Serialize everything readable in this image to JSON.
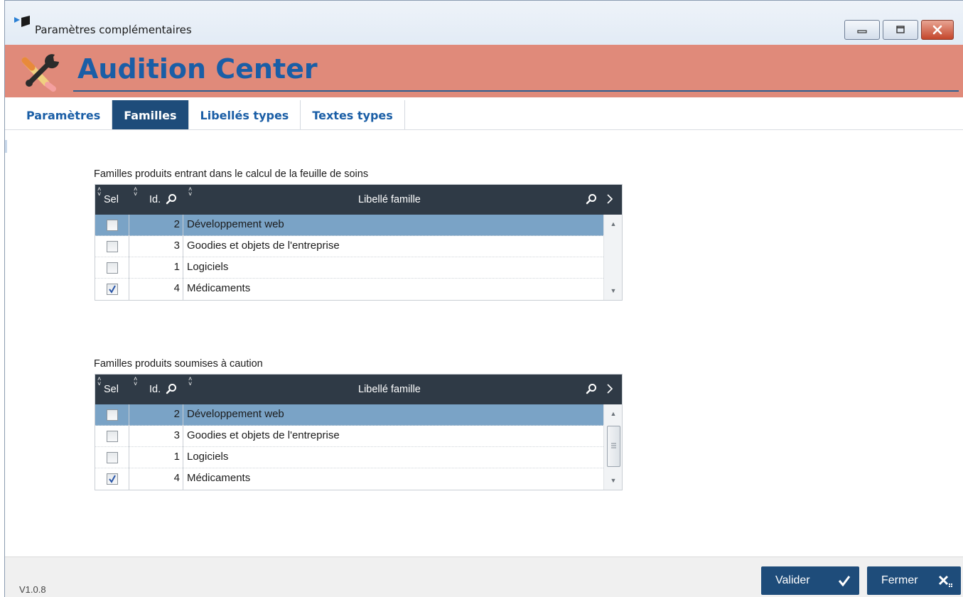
{
  "window": {
    "title": "Paramètres complémentaires"
  },
  "banner": {
    "title": "Audition Center"
  },
  "tabs": [
    {
      "label": "Paramètres",
      "active": false
    },
    {
      "label": "Familles",
      "active": true
    },
    {
      "label": "Libellés types",
      "active": false
    },
    {
      "label": "Textes types",
      "active": false
    }
  ],
  "grid1": {
    "caption": "Familles produits entrant dans le calcul de la feuille de soins",
    "headers": {
      "sel": "Sel",
      "id": "Id.",
      "libelle": "Libellé famille"
    },
    "rows": [
      {
        "id": "2",
        "libelle": "Développement web",
        "checked": false,
        "selected": true
      },
      {
        "id": "3",
        "libelle": "Goodies et objets de l'entreprise",
        "checked": false,
        "selected": false
      },
      {
        "id": "1",
        "libelle": "Logiciels",
        "checked": false,
        "selected": false
      },
      {
        "id": "4",
        "libelle": "Médicaments",
        "checked": true,
        "selected": false
      }
    ]
  },
  "grid2": {
    "caption": "Familles produits soumises à caution",
    "headers": {
      "sel": "Sel",
      "id": "Id.",
      "libelle": "Libellé famille"
    },
    "rows": [
      {
        "id": "2",
        "libelle": "Développement web",
        "checked": false,
        "selected": true
      },
      {
        "id": "3",
        "libelle": "Goodies et objets de l'entreprise",
        "checked": false,
        "selected": false
      },
      {
        "id": "1",
        "libelle": "Logiciels",
        "checked": false,
        "selected": false
      },
      {
        "id": "4",
        "libelle": "Médicaments",
        "checked": true,
        "selected": false
      }
    ]
  },
  "footer": {
    "version": "V1.0.8",
    "validate_label": "Valider",
    "close_label": "Fermer"
  },
  "colors": {
    "banner": "#e08a7a",
    "accent": "#1e4c7a",
    "title_blue": "#1a5ea6",
    "grid_header": "#2f3a46",
    "row_selected": "#7aa3c6"
  }
}
